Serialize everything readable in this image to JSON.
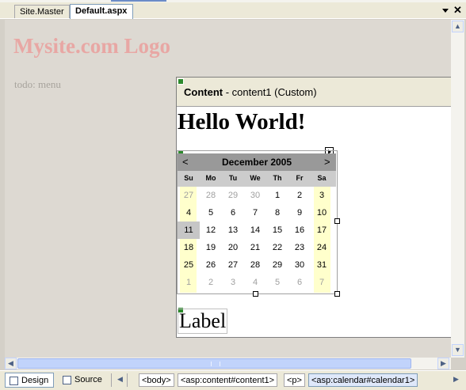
{
  "tabs": [
    {
      "label": "Site.Master",
      "active": false
    },
    {
      "label": "Default.aspx",
      "active": true
    }
  ],
  "surface": {
    "logo": "Mysite.com Logo",
    "menu": "todo: menu"
  },
  "content_region": {
    "header_bold": "Content",
    "header_rest": " - content1 (Custom)",
    "heading": "Hello World!",
    "label": "Label"
  },
  "calendar": {
    "month": "December 2005",
    "prev": "<",
    "next": ">",
    "days_of_week": [
      "Su",
      "Mo",
      "Tu",
      "We",
      "Th",
      "Fr",
      "Sa"
    ],
    "weeks": [
      [
        "27",
        "28",
        "29",
        "30",
        "1",
        "2",
        "3"
      ],
      [
        "4",
        "5",
        "6",
        "7",
        "8",
        "9",
        "10"
      ],
      [
        "11",
        "12",
        "13",
        "14",
        "15",
        "16",
        "17"
      ],
      [
        "18",
        "19",
        "20",
        "21",
        "22",
        "23",
        "24"
      ],
      [
        "25",
        "26",
        "27",
        "28",
        "29",
        "30",
        "31"
      ],
      [
        "1",
        "2",
        "3",
        "4",
        "5",
        "6",
        "7"
      ]
    ],
    "weekend_color": "#ffffcc",
    "today_color": "#c6c6c6",
    "title_color": "#999999"
  },
  "toolbar": {
    "design_label": "Design",
    "source_label": "Source",
    "breadcrumbs": [
      "<body>",
      "<asp:content#content1>",
      "<p>",
      "<asp:calendar#calendar1>"
    ]
  }
}
